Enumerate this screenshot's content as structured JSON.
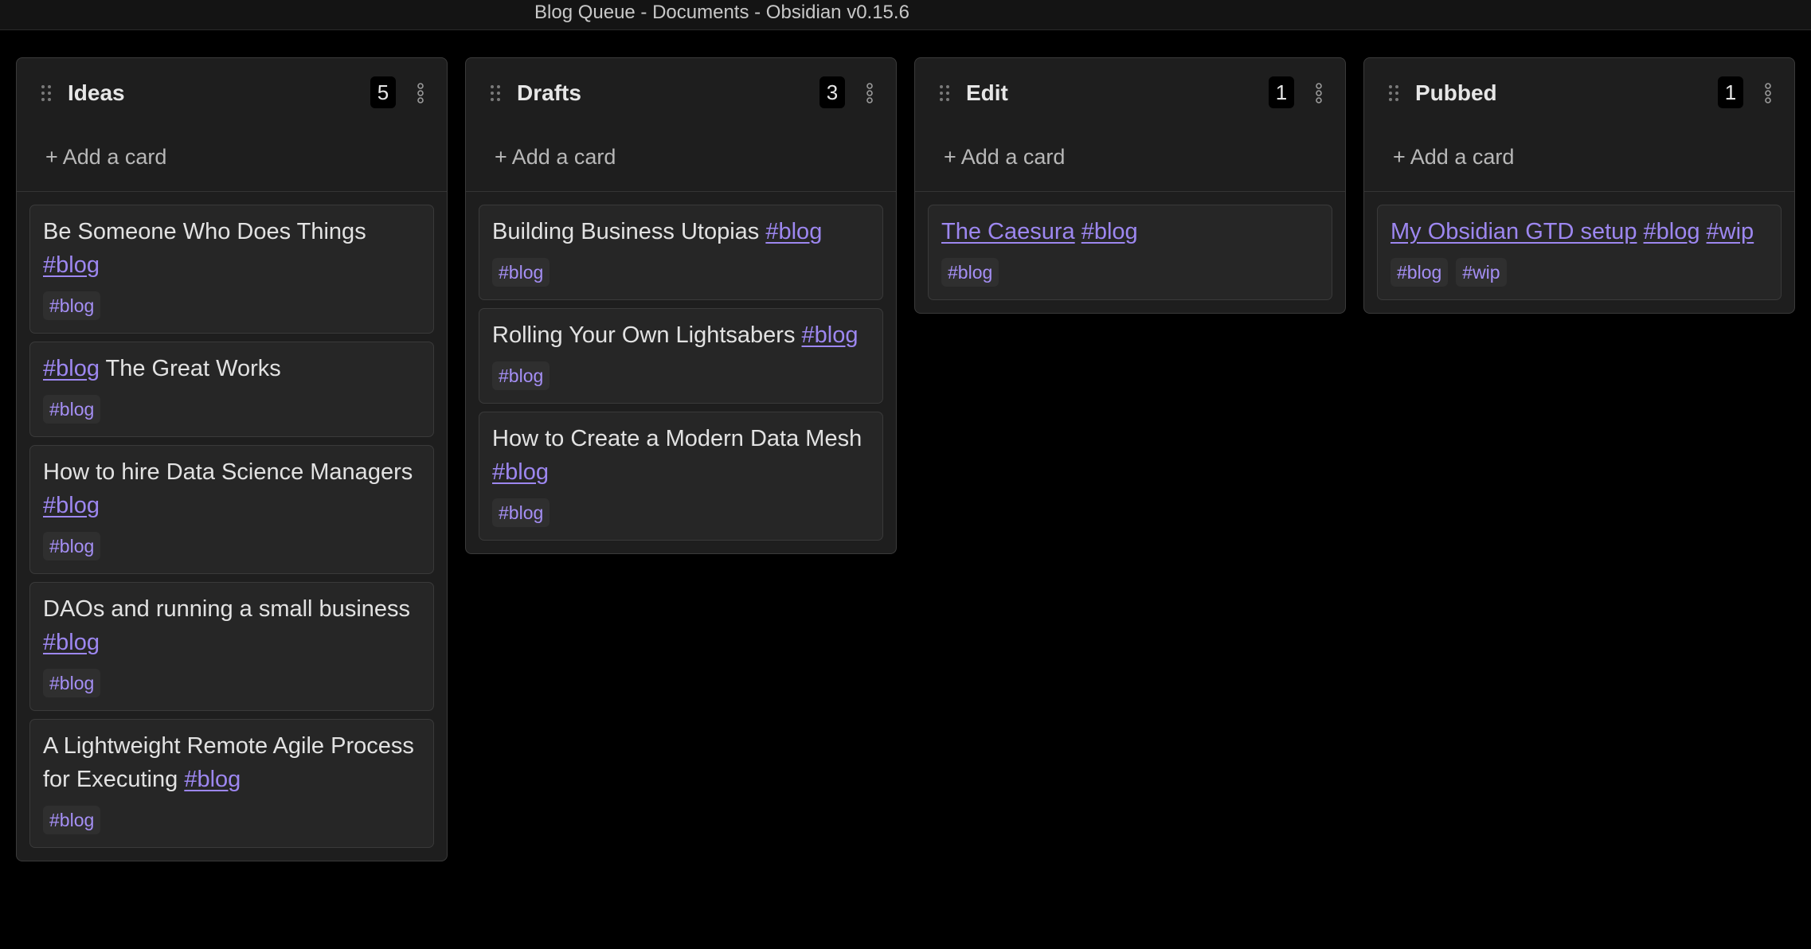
{
  "window": {
    "title": "Blog Queue - Documents - Obsidian v0.15.6"
  },
  "colors": {
    "background": "#000000",
    "lane_bg": "#1e1e1e",
    "card_bg": "#262626",
    "link": "#9d87f0",
    "tag_text": "#a58ff5"
  },
  "icons": {
    "grip": "grip-vertical-icon",
    "menu": "more-vertical-icon"
  },
  "lanes": [
    {
      "title": "Ideas",
      "count": "5",
      "add_label": "+ Add a card",
      "cards": [
        {
          "title": [
            {
              "text": "Be Someone Who Does Things "
            },
            {
              "text": "#blog",
              "link": true
            }
          ],
          "tags": [
            "#blog"
          ]
        },
        {
          "title": [
            {
              "text": "#blog",
              "link": true
            },
            {
              "text": " The Great Works"
            }
          ],
          "tags": [
            "#blog"
          ]
        },
        {
          "title": [
            {
              "text": "How to hire Data Science Managers "
            },
            {
              "text": "#blog",
              "link": true
            }
          ],
          "tags": [
            "#blog"
          ]
        },
        {
          "title": [
            {
              "text": "DAOs and running a small business "
            },
            {
              "text": "#blog",
              "link": true
            }
          ],
          "tags": [
            "#blog"
          ]
        },
        {
          "title": [
            {
              "text": "A Lightweight Remote Agile Process for Executing "
            },
            {
              "text": "#blog",
              "link": true
            }
          ],
          "tags": [
            "#blog"
          ]
        }
      ]
    },
    {
      "title": "Drafts",
      "count": "3",
      "add_label": "+ Add a card",
      "cards": [
        {
          "title": [
            {
              "text": "Building Business Utopias "
            },
            {
              "text": "#blog",
              "link": true
            }
          ],
          "tags": [
            "#blog"
          ]
        },
        {
          "title": [
            {
              "text": "Rolling Your Own Lightsabers "
            },
            {
              "text": "#blog",
              "link": true
            }
          ],
          "tags": [
            "#blog"
          ]
        },
        {
          "title": [
            {
              "text": "How to Create a Modern Data Mesh "
            },
            {
              "text": "#blog",
              "link": true
            }
          ],
          "tags": [
            "#blog"
          ]
        }
      ]
    },
    {
      "title": "Edit",
      "count": "1",
      "add_label": "+ Add a card",
      "cards": [
        {
          "title": [
            {
              "text": "The Caesura",
              "link": true
            },
            {
              "text": " "
            },
            {
              "text": "#blog",
              "link": true
            }
          ],
          "tags": [
            "#blog"
          ]
        }
      ]
    },
    {
      "title": "Pubbed",
      "count": "1",
      "add_label": "+ Add a card",
      "cards": [
        {
          "title": [
            {
              "text": "My Obsidian GTD setup",
              "link": true
            },
            {
              "text": " "
            },
            {
              "text": "#blog",
              "link": true
            },
            {
              "text": " "
            },
            {
              "text": "#wip",
              "link": true
            }
          ],
          "tags": [
            "#blog",
            "#wip"
          ]
        }
      ]
    }
  ]
}
